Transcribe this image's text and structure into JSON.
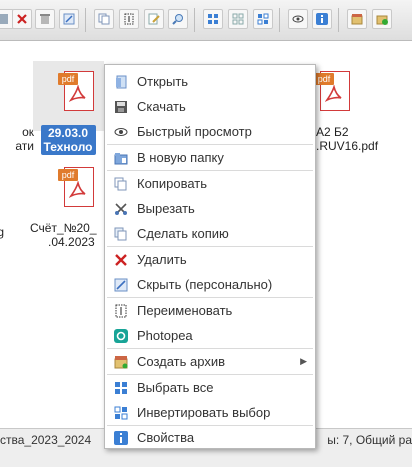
{
  "toolbar": {
    "buttons": [
      "download-icon",
      "delete-icon",
      "trash-icon",
      "hide-icon",
      "copy-icon",
      "rename-icon",
      "edit-icon",
      "search-icon",
      "view-icons-icon",
      "view-grid-icon",
      "view-tiles-icon",
      "preview-icon",
      "info-icon",
      "archive-icon",
      "extract-icon"
    ]
  },
  "files": [
    {
      "label_line1": "ок",
      "label_line2": "ати"
    },
    {
      "label_line1": "29.03.0",
      "label_line2": "Техноло"
    },
    {
      "label_line1": "А2 Б2",
      "label_line2": ".RUV16.pdf"
    },
    {
      "label_line1": "Счёт_№20_",
      "label_line2": ".04.2023"
    },
    {
      "label_line1": "g",
      "label_line2": ""
    }
  ],
  "pdf_tag": "pdf",
  "status": {
    "left": "ства_2023_2024",
    "right": "ы: 7, Общий ра"
  },
  "menu": {
    "items": [
      {
        "label": "Открыть",
        "icon": "open-icon"
      },
      {
        "label": "Скачать",
        "icon": "download-icon"
      },
      {
        "label": "Быстрый просмотр",
        "icon": "eye-icon"
      },
      {
        "label": "В новую папку",
        "icon": "new-folder-icon"
      },
      {
        "label": "Копировать",
        "icon": "copy-icon"
      },
      {
        "label": "Вырезать",
        "icon": "cut-icon"
      },
      {
        "label": "Сделать копию",
        "icon": "duplicate-icon"
      },
      {
        "label": "Удалить",
        "icon": "delete-icon"
      },
      {
        "label": "Скрыть (персонально)",
        "icon": "hide-icon"
      },
      {
        "label": "Переименовать",
        "icon": "rename-icon"
      },
      {
        "label": "Photopea",
        "icon": "photopea-icon"
      },
      {
        "label": "Создать архив",
        "icon": "archive-icon"
      },
      {
        "label": "Выбрать все",
        "icon": "select-all-icon"
      },
      {
        "label": "Инвертировать выбор",
        "icon": "invert-selection-icon"
      },
      {
        "label": "Свойства",
        "icon": "info-icon"
      }
    ]
  },
  "colors": {
    "selection": "#3a78c9",
    "pdf_red": "#d23a3a",
    "pdf_tag": "#e07b2c",
    "info_blue": "#3b7fd4"
  }
}
